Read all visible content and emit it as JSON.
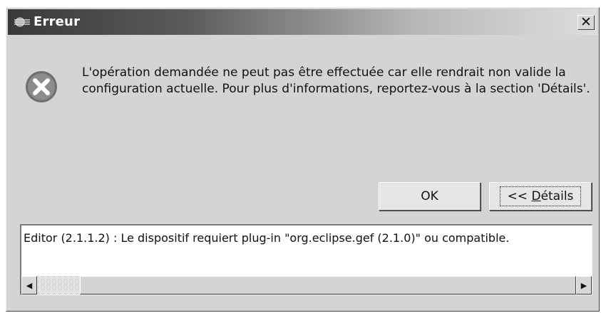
{
  "dialog": {
    "title": "Erreur",
    "close_label": "✕",
    "title_icon": "eclipse-app-icon",
    "status_icon": "error-x-icon",
    "message": "L'opération demandée ne peut pas être effectuée car elle rendrait non valide la configuration actuelle. Pour plus d'informations, reportez-vous à la section 'Détails'.",
    "buttons": {
      "ok": "OK",
      "details_prefix": "<< ",
      "details_mnemonic": "D",
      "details_rest": "étails"
    },
    "details": {
      "text": "Editor (2.1.1.2) : Le dispositif requiert plug-in \"org.eclipse.gef (2.1.0)\" ou compatible.",
      "scroll_left": "◀",
      "scroll_right": "▶"
    }
  }
}
